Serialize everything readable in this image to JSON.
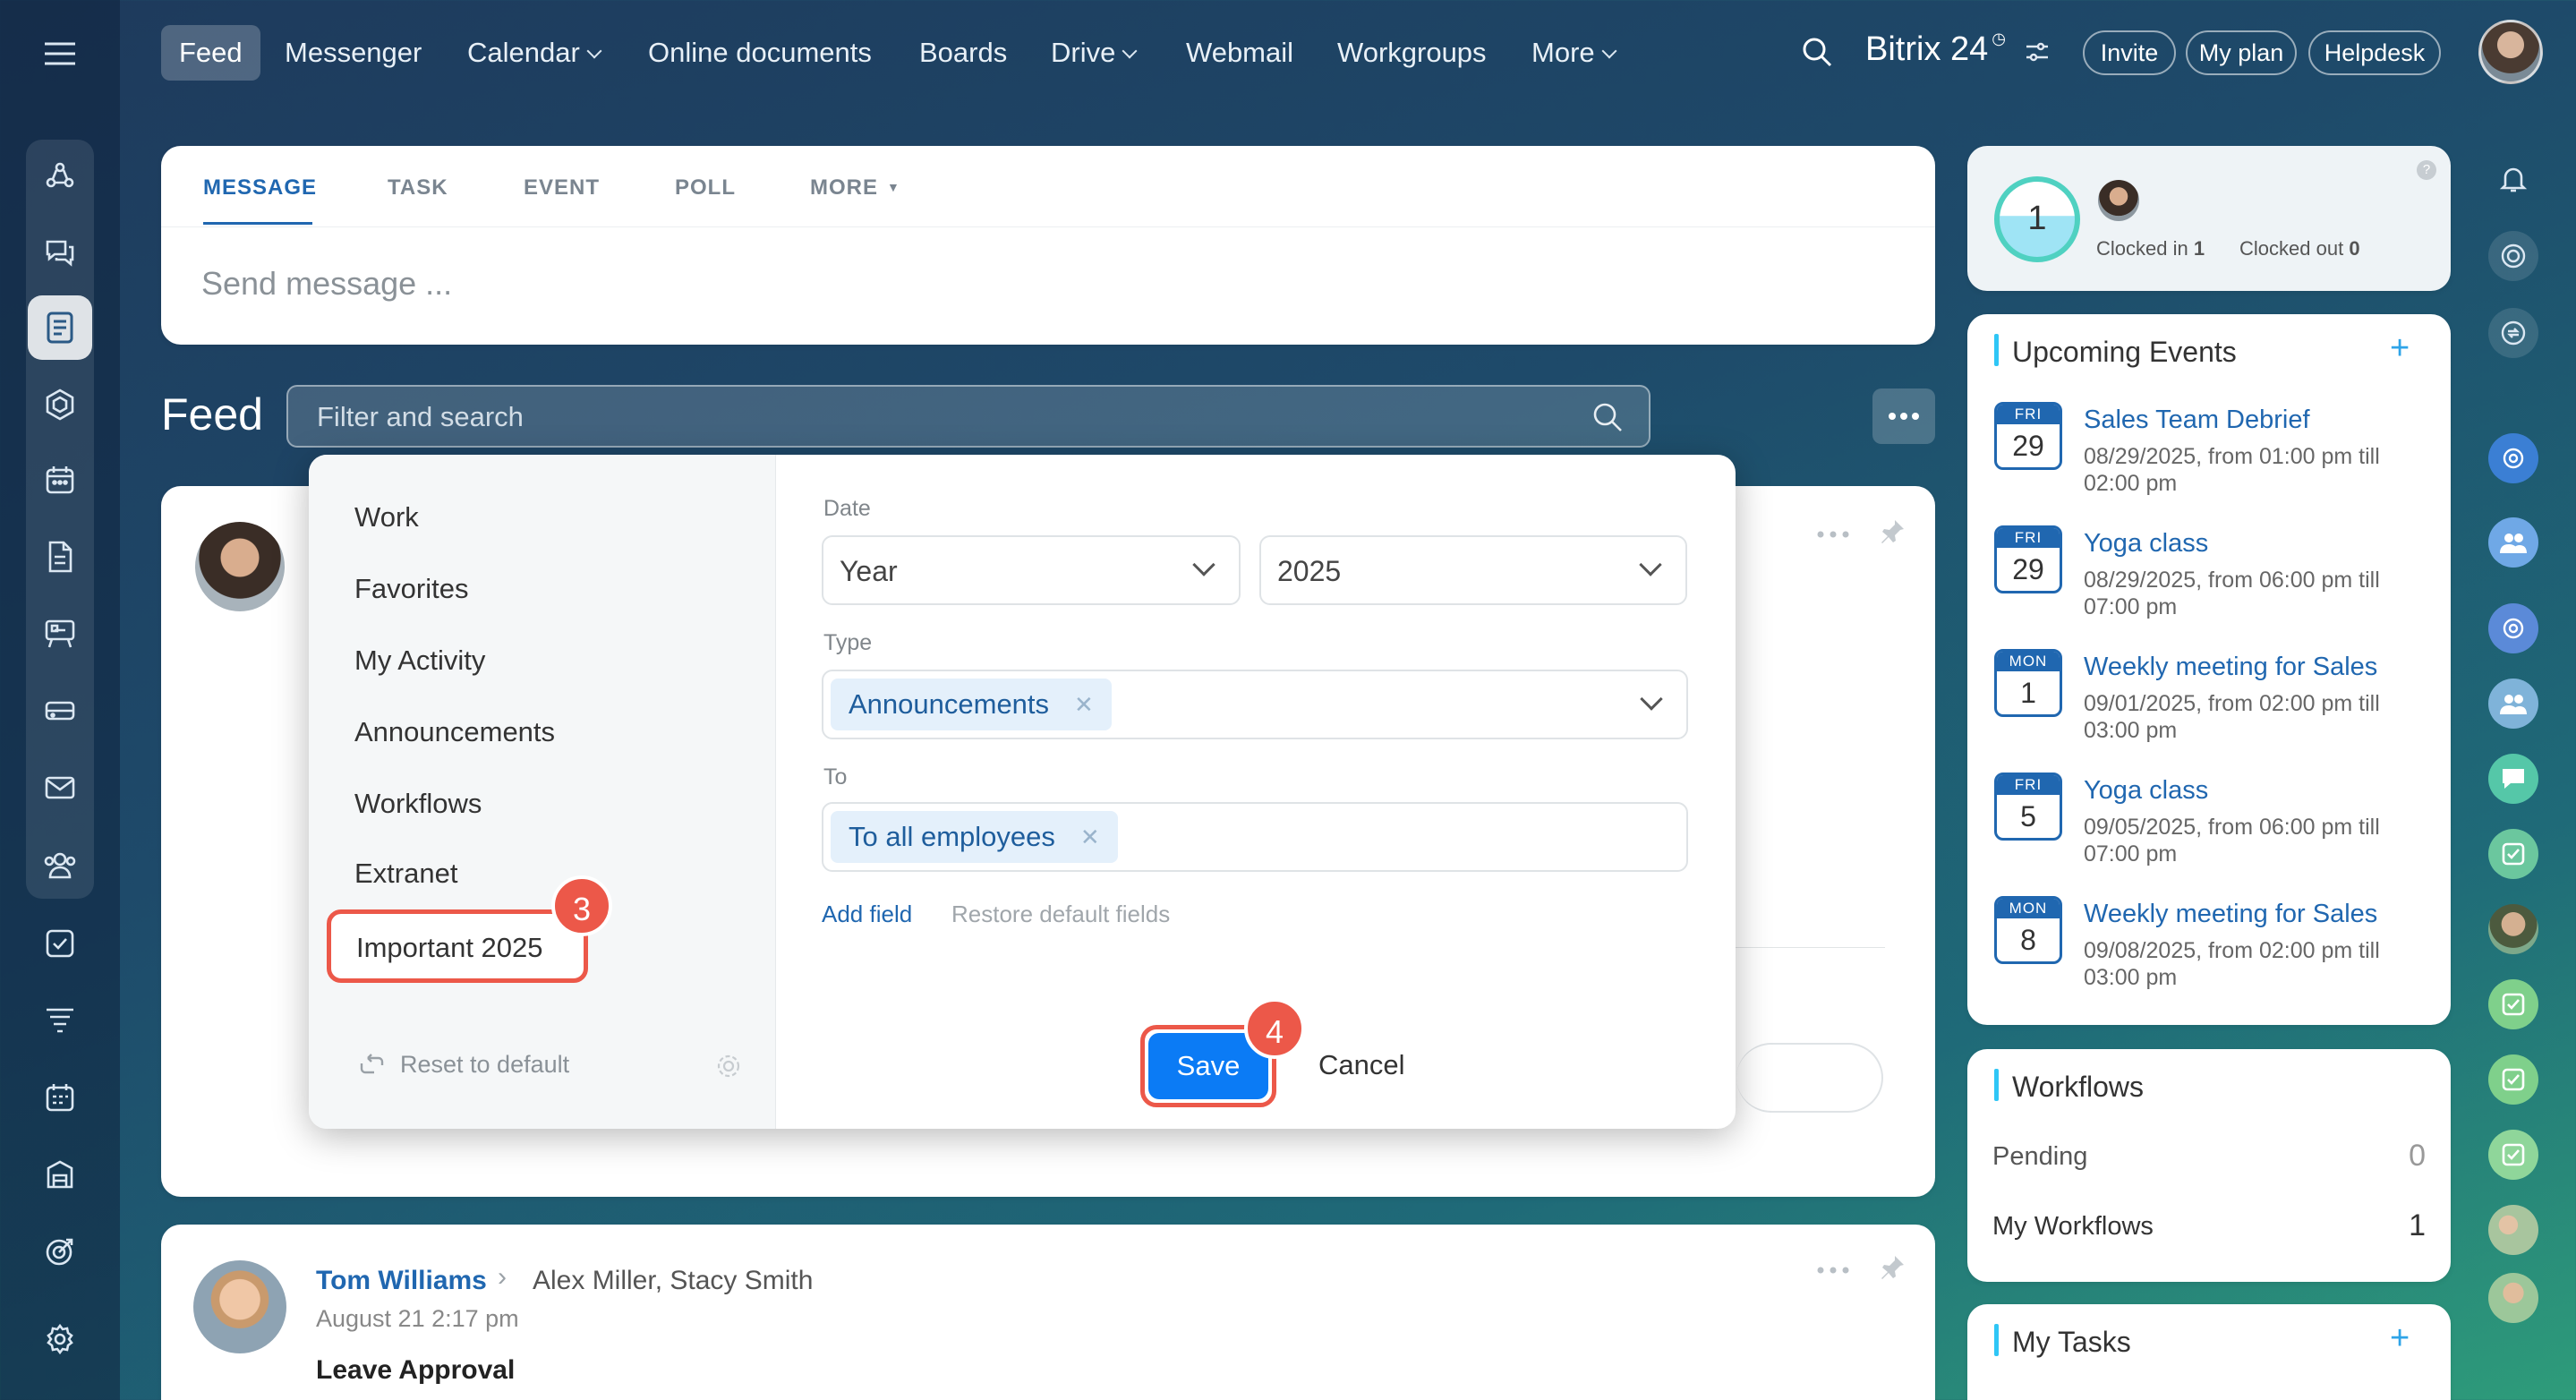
{
  "nav": {
    "items": [
      {
        "label": "Feed",
        "active": true
      },
      {
        "label": "Messenger"
      },
      {
        "label": "Calendar",
        "dropdown": true
      },
      {
        "label": "Online documents"
      },
      {
        "label": "Boards"
      },
      {
        "label": "Drive",
        "dropdown": true
      },
      {
        "label": "Webmail"
      },
      {
        "label": "Workgroups"
      },
      {
        "label": "More",
        "dropdown": true
      }
    ],
    "brand": "Bitrix 24",
    "invite": "Invite",
    "my_plan": "My plan",
    "helpdesk": "Helpdesk"
  },
  "composer": {
    "tabs": [
      "MESSAGE",
      "TASK",
      "EVENT",
      "POLL",
      "MORE"
    ],
    "placeholder": "Send message ..."
  },
  "feed": {
    "title": "Feed",
    "search_placeholder": "Filter and search"
  },
  "filter": {
    "presets": [
      "Work",
      "Favorites",
      "My Activity",
      "Announcements",
      "Workflows",
      "Extranet",
      "Important 2025"
    ],
    "reset": "Reset to default",
    "date_label": "Date",
    "date_period": "Year",
    "date_value": "2025",
    "type_label": "Type",
    "type_chip": "Announcements",
    "to_label": "To",
    "to_chip": "To all employees",
    "add_field": "Add field",
    "restore": "Restore default fields",
    "save": "Save",
    "cancel": "Cancel",
    "step_badges": [
      "3",
      "4"
    ]
  },
  "post": {
    "author": "Tom Williams",
    "recipients": "Alex Miller, Stacy Smith",
    "date": "August 21 2:17 pm",
    "title": "Leave Approval"
  },
  "timeman": {
    "count": "1",
    "clocked_in_label": "Clocked in",
    "clocked_in_value": "1",
    "clocked_out_label": "Clocked out",
    "clocked_out_value": "0"
  },
  "events": {
    "title": "Upcoming Events",
    "items": [
      {
        "weekday": "FRI",
        "day": "29",
        "title": "Sales Team Debrief",
        "when": "08/29/2025, from 01:00 pm till 02:00 pm"
      },
      {
        "weekday": "FRI",
        "day": "29",
        "title": "Yoga class",
        "when": "08/29/2025, from 06:00 pm till 07:00 pm"
      },
      {
        "weekday": "MON",
        "day": "1",
        "title": "Weekly meeting for Sales",
        "when": "09/01/2025, from 02:00 pm till 03:00 pm"
      },
      {
        "weekday": "FRI",
        "day": "5",
        "title": "Yoga class",
        "when": "09/05/2025, from 06:00 pm till 07:00 pm"
      },
      {
        "weekday": "MON",
        "day": "8",
        "title": "Weekly meeting for Sales",
        "when": "09/08/2025, from 02:00 pm till 03:00 pm"
      }
    ]
  },
  "workflows": {
    "title": "Workflows",
    "pending_label": "Pending",
    "pending_value": "0",
    "mine_label": "My Workflows",
    "mine_value": "1"
  },
  "tasks": {
    "title": "My Tasks"
  },
  "colors": {
    "accent": "#2067b0",
    "save": "#0b7bf5",
    "highlight": "#ec5849",
    "cyan": "#2fc6f6"
  }
}
